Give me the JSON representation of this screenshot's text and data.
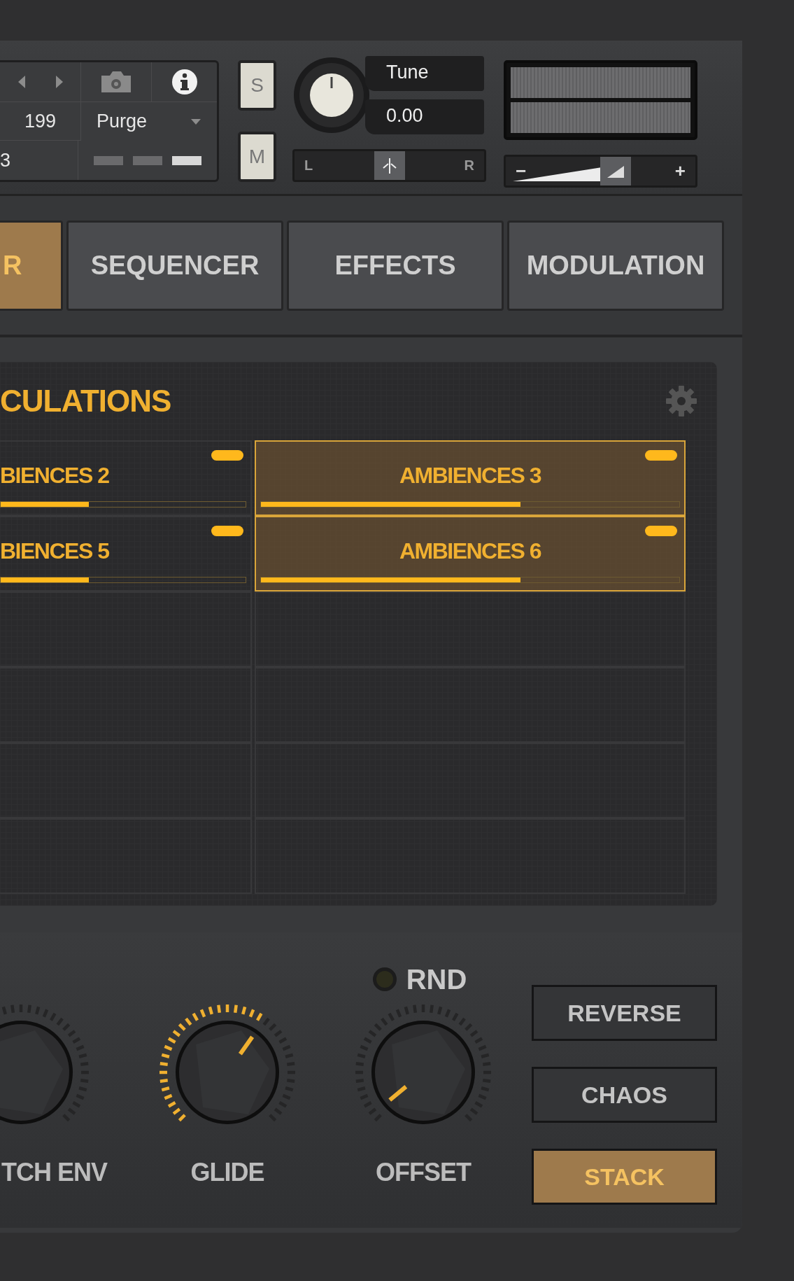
{
  "header": {
    "preset_panel": {
      "number": "199",
      "purge": "Purge",
      "cut_value": "3",
      "bars": [
        {
          "selected": false
        },
        {
          "selected": false
        },
        {
          "selected": true
        }
      ]
    },
    "solo": "S",
    "mute": "M",
    "tune": {
      "label": "Tune",
      "value": "0.00"
    },
    "pan": {
      "left": "L",
      "right": "R",
      "level": 0.5
    },
    "volume": {
      "minus": "−",
      "plus": "+",
      "level": 0.58
    }
  },
  "tabs": [
    {
      "label": "R",
      "selected": true
    },
    {
      "label": "SEQUENCER",
      "selected": false
    },
    {
      "label": "EFFECTS",
      "selected": false
    },
    {
      "label": "MODULATION",
      "selected": false
    }
  ],
  "articulations": {
    "title": "CULATIONS",
    "cells": [
      {
        "label": "BIENCES 2",
        "selected": false,
        "toggle_on": true,
        "level": 0.36
      },
      {
        "label": "AMBIENCES 3",
        "selected": true,
        "toggle_on": true,
        "level": 0.62
      },
      {
        "label": "BIENCES 5",
        "selected": false,
        "toggle_on": true,
        "level": 0.36
      },
      {
        "label": "AMBIENCES 6",
        "selected": true,
        "toggle_on": true,
        "level": 0.62
      }
    ]
  },
  "controls": {
    "knobs": [
      {
        "label": "TCH ENV"
      },
      {
        "label": "GLIDE"
      },
      {
        "label": "OFFSET"
      }
    ],
    "rnd": {
      "label": "RND",
      "on": false
    },
    "buttons": [
      {
        "label": "REVERSE",
        "selected": false
      },
      {
        "label": "CHAOS",
        "selected": false
      },
      {
        "label": "STACK",
        "selected": true
      }
    ]
  }
}
